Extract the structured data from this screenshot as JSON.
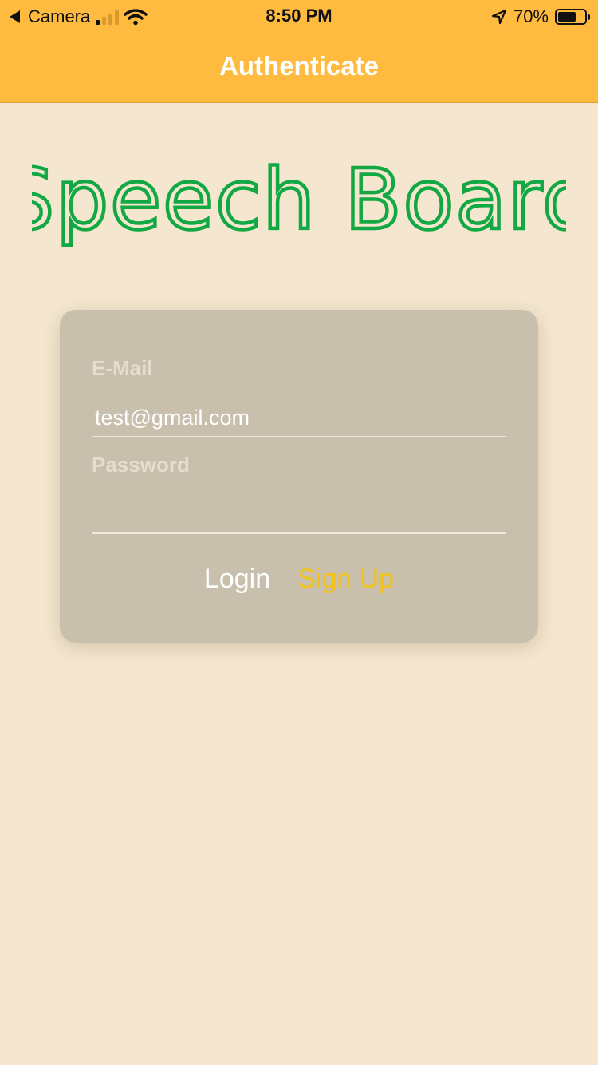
{
  "status_bar": {
    "back_app": "Camera",
    "time": "8:50 PM",
    "battery_percent_label": "70%",
    "battery_level": 0.7
  },
  "nav": {
    "title": "Authenticate"
  },
  "logo": {
    "text": "Speech Board",
    "color": "#12a944"
  },
  "form": {
    "email_label": "E-Mail",
    "email_value": "test@gmail.com",
    "password_label": "Password",
    "password_value": ""
  },
  "buttons": {
    "login": "Login",
    "signup": "Sign Up"
  },
  "colors": {
    "header": "#febb40",
    "background": "#f5e7cf",
    "card": "#c9bfad",
    "signup_accent": "#f2c316"
  }
}
